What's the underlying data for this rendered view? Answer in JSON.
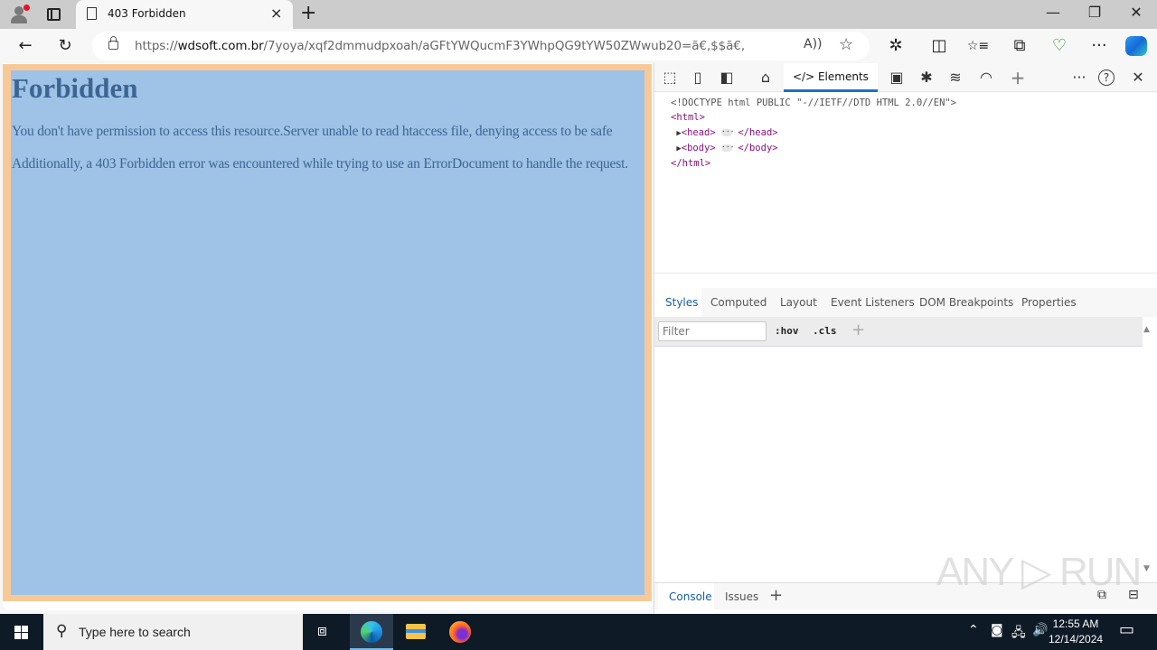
{
  "browser": {
    "tab": {
      "title": "403 Forbidden",
      "close_label": "×"
    },
    "new_tab_label": "+",
    "window_controls": {
      "minimize": "—",
      "restore": "❐",
      "close": "✕"
    },
    "toolbar": {
      "back": "←",
      "reload": "↻",
      "url_prefix": "https://",
      "url_domain": "wdsoft.com.br",
      "url_path": "/7yoya/xqf2dmmudpxoah/aGFtYWQucmF3YWhpQG9tYW50ZWwub20=ã€‚$$ã€‚",
      "read_aloud": "A))",
      "favorite": "☆",
      "extensions": "✲",
      "split_screen": "◫",
      "favorites": "☆≡",
      "collections": "⧉",
      "browser_essentials": "♡",
      "more": "···"
    }
  },
  "page": {
    "heading": "Forbidden",
    "paragraph1": "You don't have permission to access this resource.Server unable to read htaccess file, denying access to be safe",
    "paragraph2": "Additionally, a 403 Forbidden error was encountered while trying to use an ErrorDocument to handle the request."
  },
  "devtools": {
    "toolbar": {
      "inspect": "⬚",
      "device": "▯",
      "dock": "◧",
      "home": "⌂",
      "elements_tab": "</> Elements",
      "console_icon": "▣",
      "sources_icon": "✱",
      "network_icon": "≋",
      "performance_icon": "◠",
      "add_tool": "+",
      "more": "···",
      "help": "?",
      "close": "✕"
    },
    "dom": {
      "doctype": "<!DOCTYPE html PUBLIC \"-//IETF//DTD HTML 2.0//EN\">",
      "html_open": "<html>",
      "head": "<head>",
      "head_close": "</head>",
      "body": "<body>",
      "body_close": "</body>",
      "html_close": "</html>",
      "ellipsis": "···",
      "expand": "▶"
    },
    "sub_tabs": [
      "Styles",
      "Computed",
      "Layout",
      "Event Listeners",
      "DOM Breakpoints",
      "Properties"
    ],
    "filter_placeholder": "Filter",
    "hov_label": ":hov",
    "cls_label": ".cls",
    "new_rule": "+",
    "drawer_tabs": [
      "Console",
      "Issues"
    ],
    "drawer_add": "+"
  },
  "watermark": "ANY ▷ RUN",
  "taskbar": {
    "search_placeholder": "Type here to search",
    "time": "12:55 AM",
    "date": "12/14/2024",
    "tray_chevron": "^",
    "notifications": "▭"
  }
}
